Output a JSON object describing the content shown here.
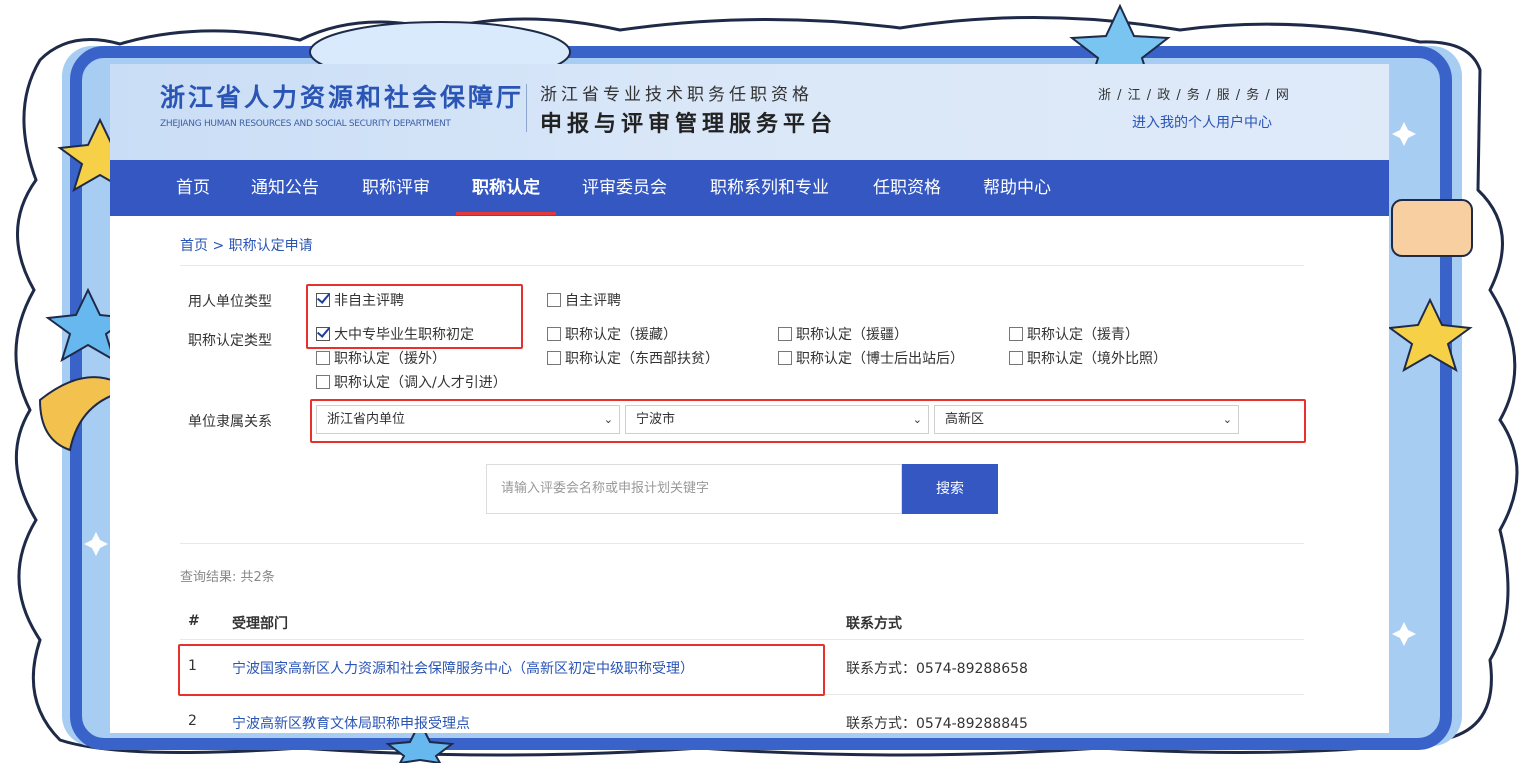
{
  "header": {
    "logo_cn": "浙江省人力资源和社会保障厅",
    "logo_en": "ZHEJIANG HUMAN RESOURCES AND SOCIAL SECURITY DEPARTMENT",
    "sub_title": "浙江省专业技术职务任职资格",
    "platform_title": "申报与评审管理服务平台",
    "gov_link": "浙 / 江 / 政 / 务 / 服 / 务 / 网",
    "user_center": "进入我的个人用户中心"
  },
  "nav": {
    "items": [
      "首页",
      "通知公告",
      "职称评审",
      "职称认定",
      "评审委员会",
      "职称系列和专业",
      "任职资格",
      "帮助中心"
    ],
    "active": "职称认定"
  },
  "breadcrumb": "首页 > 职称认定申请",
  "filters": {
    "employer_type_label": "用人单位类型",
    "employer_types": [
      {
        "label": "非自主评聘",
        "checked": true
      },
      {
        "label": "自主评聘",
        "checked": false
      }
    ],
    "cert_type_label": "职称认定类型",
    "cert_types": [
      {
        "label": "大中专毕业生职称初定",
        "checked": true
      },
      {
        "label": "职称认定（援藏）",
        "checked": false
      },
      {
        "label": "职称认定（援疆）",
        "checked": false
      },
      {
        "label": "职称认定（援青）",
        "checked": false
      },
      {
        "label": "职称认定（援外）",
        "checked": false
      },
      {
        "label": "职称认定（东西部扶贫）",
        "checked": false
      },
      {
        "label": "职称认定（博士后出站后）",
        "checked": false
      },
      {
        "label": "职称认定（境外比照）",
        "checked": false
      },
      {
        "label": "职称认定（调入/人才引进）",
        "checked": false
      }
    ],
    "affiliation_label": "单位隶属关系",
    "affiliation_selects": [
      "浙江省内单位",
      "宁波市",
      "高新区"
    ]
  },
  "search": {
    "placeholder": "请输入评委会名称或申报计划关键字",
    "button_label": "搜索"
  },
  "results": {
    "count_text": "查询结果: 共2条",
    "headers": [
      "#",
      "受理部门",
      "联系方式"
    ],
    "rows": [
      {
        "index": "1",
        "department": "宁波国家高新区人力资源和社会保障服务中心（高新区初定中级职称受理）",
        "contact": "联系方式：0574-89288658"
      },
      {
        "index": "2",
        "department": "宁波高新区教育文体局职称申报受理点",
        "contact": "联系方式：0574-89288845"
      }
    ]
  },
  "colors": {
    "nav_bg": "#3457c2",
    "link": "#2a55b5",
    "highlight": "#e5322d",
    "frame_blue": "#3a63c9"
  }
}
